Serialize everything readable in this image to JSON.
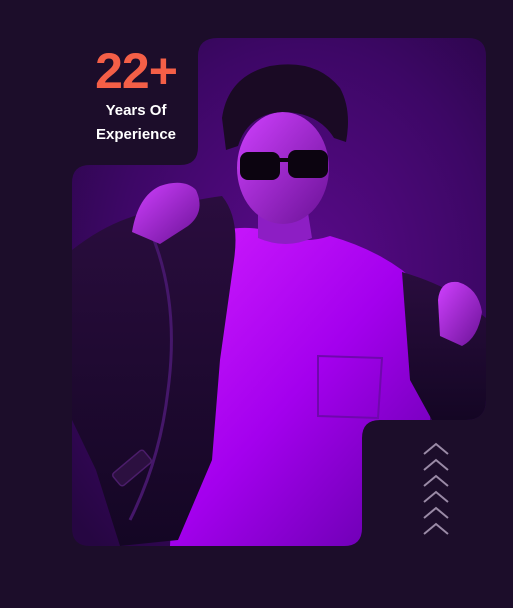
{
  "experience": {
    "number": "22+",
    "label_line1": "Years Of",
    "label_line2": "Experience"
  },
  "colors": {
    "background": "#1c0d2a",
    "frame": "#2b0a44",
    "accent": "#f45f47",
    "photo_glow": "#b800ff"
  },
  "image": {
    "description_icon": "person-photo",
    "decoration": "up-chevrons-icon"
  }
}
